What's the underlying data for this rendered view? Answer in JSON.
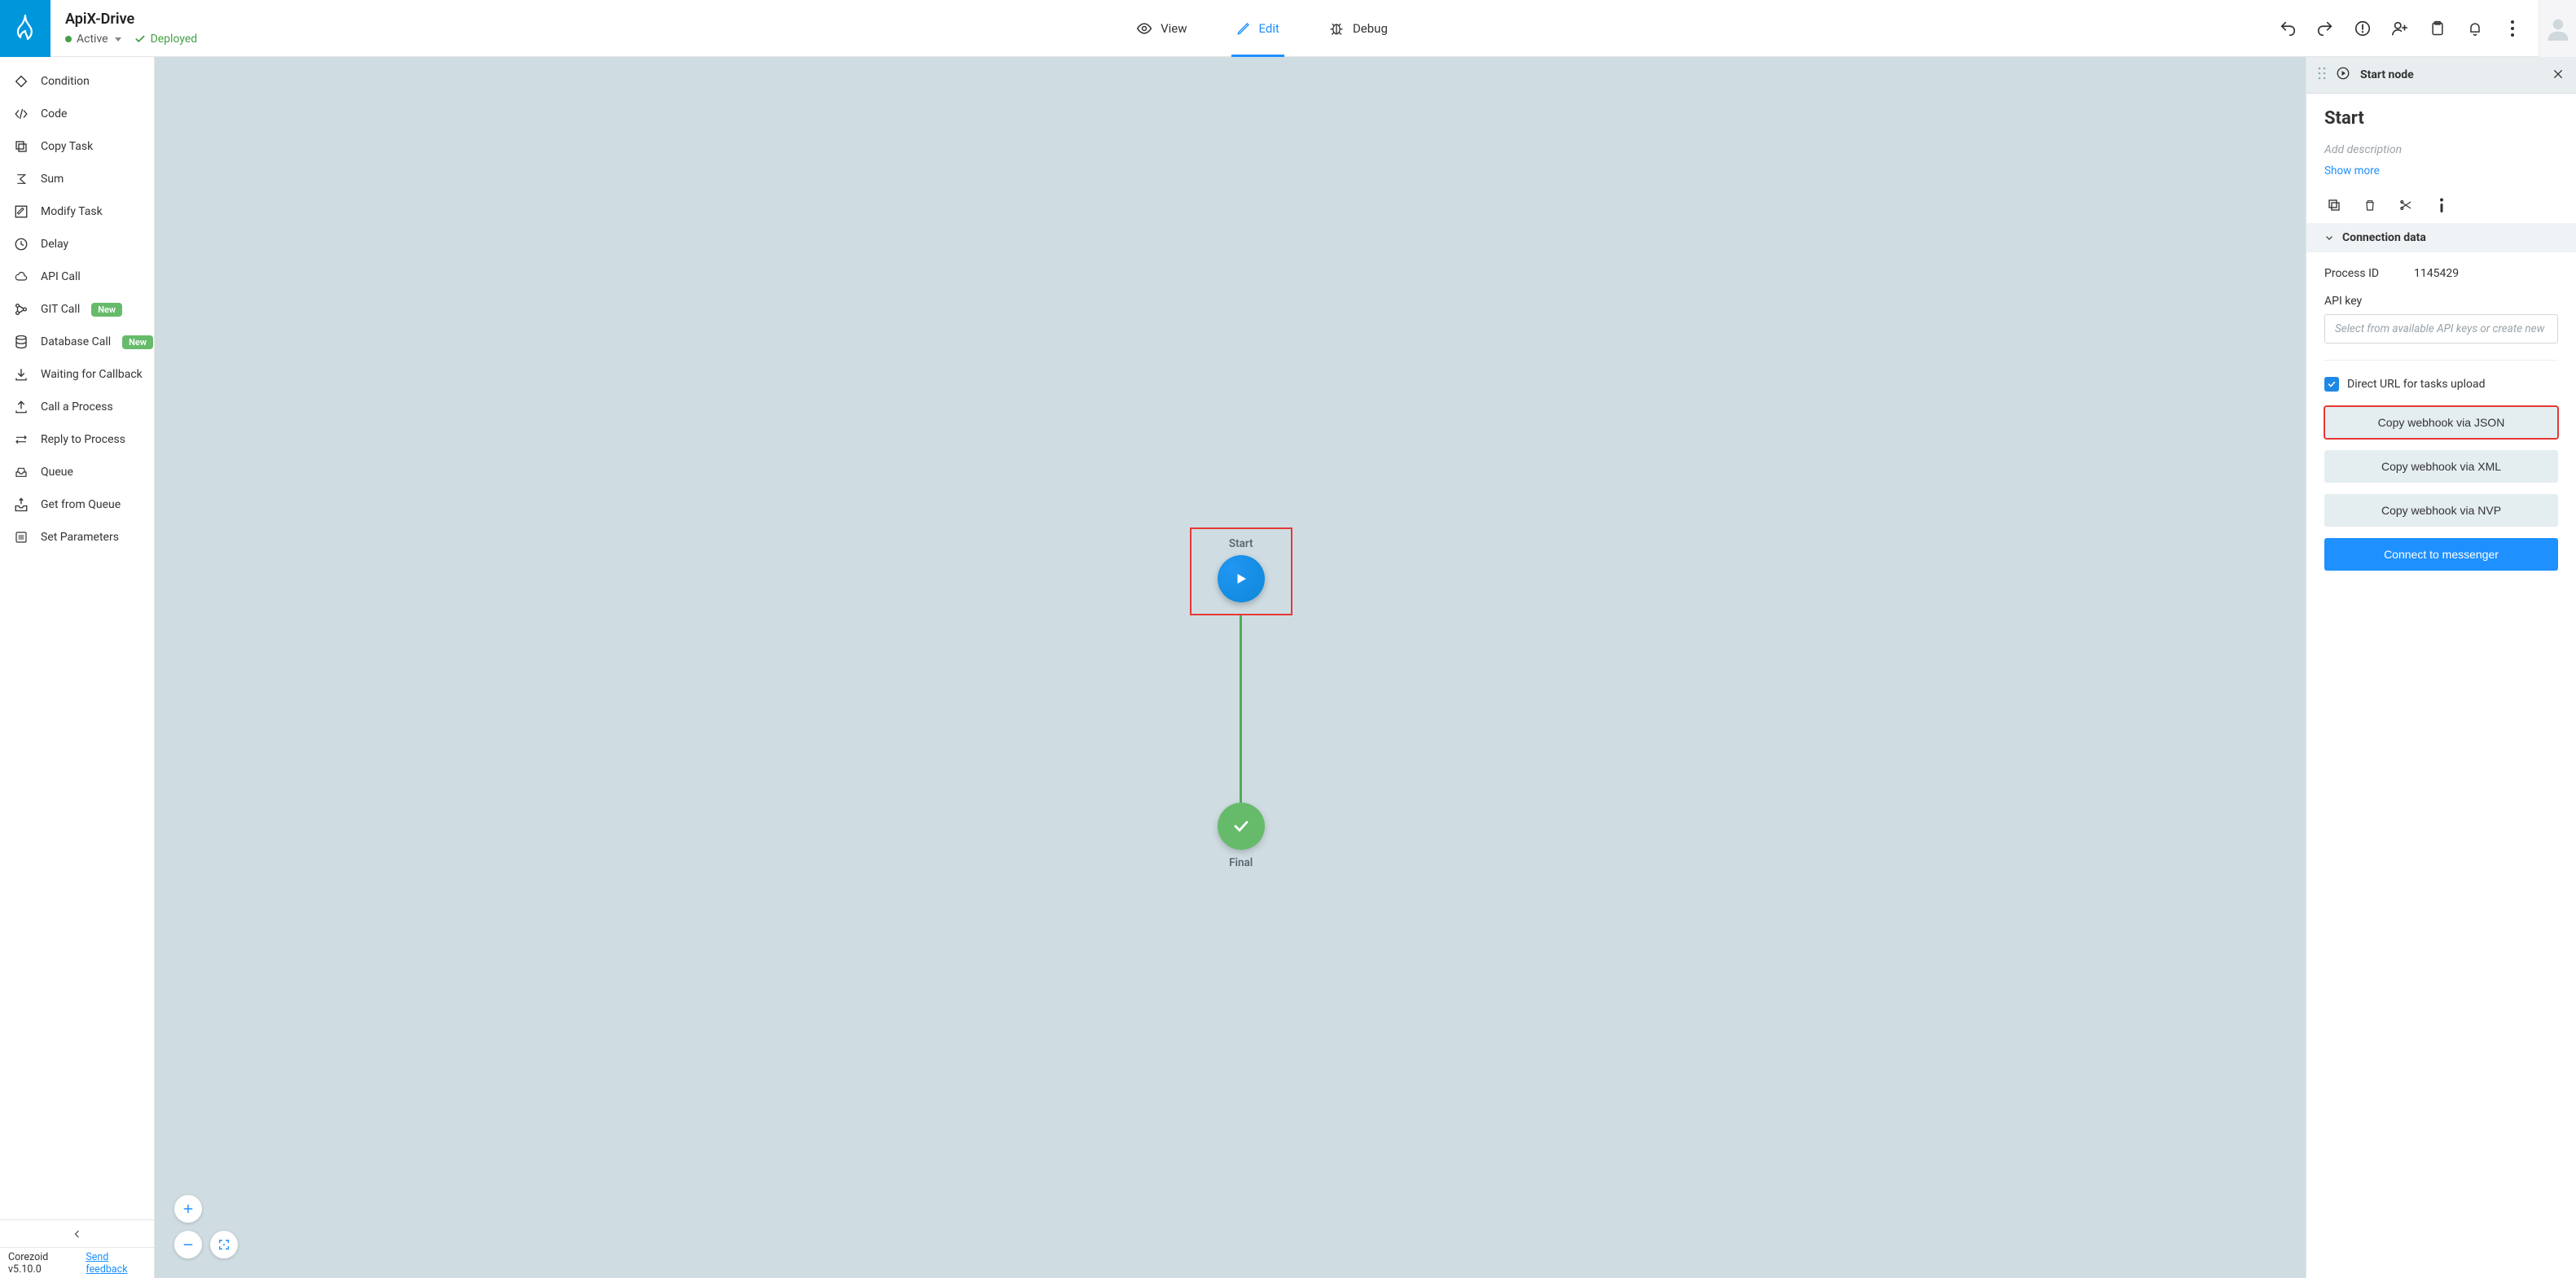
{
  "header": {
    "title": "ApiX-Drive",
    "status_label": "Active",
    "deployed_label": "Deployed",
    "tabs": {
      "view": "View",
      "edit": "Edit",
      "debug": "Debug"
    }
  },
  "sidebar": {
    "items": [
      {
        "id": "condition",
        "label": "Condition",
        "badge": null
      },
      {
        "id": "code",
        "label": "Code",
        "badge": null
      },
      {
        "id": "copy-task",
        "label": "Copy Task",
        "badge": null
      },
      {
        "id": "sum",
        "label": "Sum",
        "badge": null
      },
      {
        "id": "modify-task",
        "label": "Modify Task",
        "badge": null
      },
      {
        "id": "delay",
        "label": "Delay",
        "badge": null
      },
      {
        "id": "api-call",
        "label": "API Call",
        "badge": null
      },
      {
        "id": "git-call",
        "label": "GIT Call",
        "badge": "New"
      },
      {
        "id": "database-call",
        "label": "Database Call",
        "badge": "New"
      },
      {
        "id": "waiting-callback",
        "label": "Waiting for Callback",
        "badge": null
      },
      {
        "id": "call-process",
        "label": "Call a Process",
        "badge": null
      },
      {
        "id": "reply-process",
        "label": "Reply to Process",
        "badge": null
      },
      {
        "id": "queue",
        "label": "Queue",
        "badge": null
      },
      {
        "id": "get-queue",
        "label": "Get from Queue",
        "badge": null
      },
      {
        "id": "set-parameters",
        "label": "Set Parameters",
        "badge": null
      }
    ],
    "footer_version": "Corezoid v5.10.0",
    "footer_feedback": "Send feedback"
  },
  "canvas": {
    "start_node_label": "Start",
    "final_node_label": "Final"
  },
  "panel": {
    "header_title": "Start node",
    "node_name": "Start",
    "description_placeholder": "Add description",
    "show_more": "Show more",
    "section_title": "Connection data",
    "process_id_label": "Process ID",
    "process_id_value": "1145429",
    "api_key_label": "API key",
    "api_key_placeholder": "Select from available API keys or create new",
    "direct_url_label": "Direct URL for tasks upload",
    "direct_url_checked": true,
    "btn_json": "Copy webhook via JSON",
    "btn_xml": "Copy webhook via XML",
    "btn_nvp": "Copy webhook via NVP",
    "btn_connect": "Connect to messenger"
  }
}
